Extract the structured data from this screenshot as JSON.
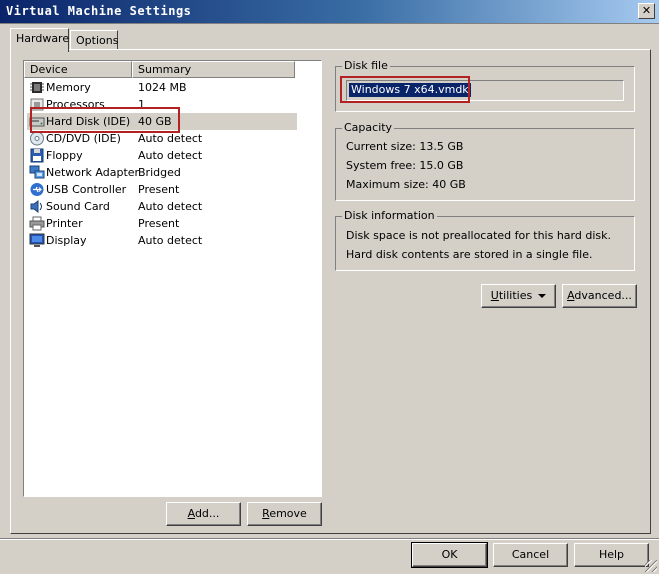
{
  "window": {
    "title": "Virtual Machine Settings",
    "close_glyph": "✕"
  },
  "tabs": [
    {
      "label": "Hardware"
    },
    {
      "label": "Options"
    }
  ],
  "device_list": {
    "headers": {
      "device": "Device",
      "summary": "Summary"
    },
    "rows": [
      {
        "device": "Memory",
        "summary": "1024 MB",
        "icon": "memory-icon"
      },
      {
        "device": "Processors",
        "summary": "1",
        "icon": "processor-icon"
      },
      {
        "device": "Hard Disk (IDE)",
        "summary": "40 GB",
        "icon": "hard-disk-icon",
        "selected": true
      },
      {
        "device": "CD/DVD (IDE)",
        "summary": "Auto detect",
        "icon": "cd-dvd-icon"
      },
      {
        "device": "Floppy",
        "summary": "Auto detect",
        "icon": "floppy-icon"
      },
      {
        "device": "Network Adapter",
        "summary": "Bridged",
        "icon": "network-adapter-icon"
      },
      {
        "device": "USB Controller",
        "summary": "Present",
        "icon": "usb-icon"
      },
      {
        "device": "Sound Card",
        "summary": "Auto detect",
        "icon": "sound-card-icon"
      },
      {
        "device": "Printer",
        "summary": "Present",
        "icon": "printer-icon"
      },
      {
        "device": "Display",
        "summary": "Auto detect",
        "icon": "display-icon"
      }
    ],
    "add_button": {
      "pre": "",
      "u": "A",
      "post": "dd..."
    },
    "remove_button": {
      "pre": "",
      "u": "R",
      "post": "emove"
    }
  },
  "disk_file": {
    "legend": "Disk file",
    "value": "Windows 7 x64.vmdk"
  },
  "capacity": {
    "legend": "Capacity",
    "current_size": "Current size: 13.5 GB",
    "system_free": "System free: 15.0 GB",
    "maximum_size": "Maximum size: 40 GB"
  },
  "disk_information": {
    "legend": "Disk information",
    "line1": "Disk space is not preallocated for this hard disk.",
    "line2": "Hard disk contents are stored in a single file."
  },
  "actions": {
    "utilities": {
      "pre": "",
      "u": "U",
      "post": "tilities"
    },
    "advanced": {
      "pre": "",
      "u": "A",
      "post": "dvanced..."
    }
  },
  "footer": {
    "ok": "OK",
    "cancel": "Cancel",
    "help": "Help"
  },
  "colors": {
    "face": "#d4d0c8",
    "title_start": "#0a246a",
    "title_end": "#a6caf0",
    "highlight_box": "#b22222",
    "selection": "#0a246a"
  }
}
